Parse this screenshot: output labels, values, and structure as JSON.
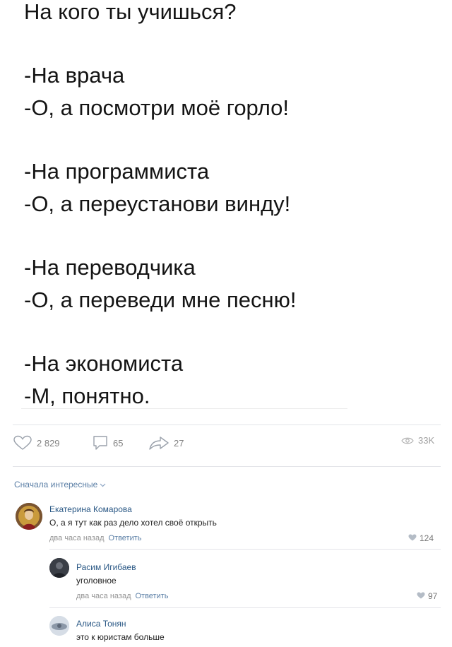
{
  "post": {
    "title": "На кого ты учишься?",
    "blocks": [
      [
        "-На врача",
        "-О, а посмотри моё горло!"
      ],
      [
        "-На программиста",
        "-О, а переустанови винду!"
      ],
      [
        "-На переводчика",
        "-О, а переведи мне песню!"
      ],
      [
        "-На экономиста",
        "-М, понятно."
      ]
    ]
  },
  "actions": {
    "likes": "2 829",
    "comments": "65",
    "shares": "27",
    "views": "33K"
  },
  "sort_label": "Сначала интересные",
  "comments": [
    {
      "name": "Екатерина Комарова",
      "text": "О, а я тут как раз дело хотел своё открыть",
      "time": "два часа назад",
      "reply": "Ответить",
      "likes": "124"
    },
    {
      "name": "Расим Игибаев",
      "text": "уголовное",
      "time": "два часа назад",
      "reply": "Ответить",
      "likes": "97"
    },
    {
      "name": "Алиса Тонян",
      "text": "это к юристам больше"
    }
  ],
  "colors": {
    "link": "#2a5885",
    "muted": "#939393",
    "separator": "#e3e4e8"
  },
  "icons": [
    "heart-icon",
    "comment-icon",
    "share-icon",
    "eye-icon",
    "chevron-down-icon"
  ]
}
